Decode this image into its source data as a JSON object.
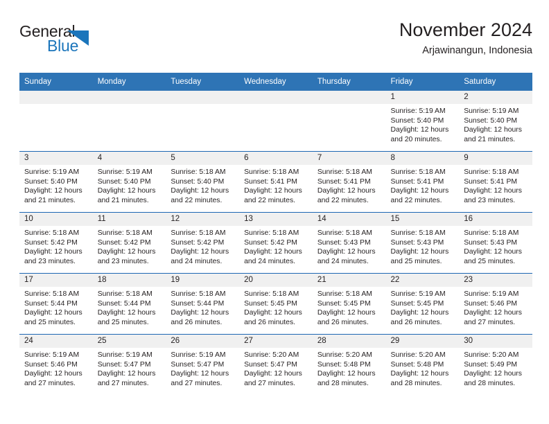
{
  "brand": {
    "line1": "General",
    "line2": "Blue",
    "triangle_color": "#1b75bb"
  },
  "header": {
    "month_title": "November 2024",
    "location": "Arjawinangun, Indonesia"
  },
  "colors": {
    "header_blue": "#2e74b5",
    "row_divider_blue": "#1b66b3",
    "daynum_band": "#f0f0f0",
    "text": "#231f20"
  },
  "weekday_headers": [
    "Sunday",
    "Monday",
    "Tuesday",
    "Wednesday",
    "Thursday",
    "Friday",
    "Saturday"
  ],
  "weeks": [
    [
      {
        "day": "",
        "sunrise": "",
        "sunset": "",
        "daylight1": "",
        "daylight2": ""
      },
      {
        "day": "",
        "sunrise": "",
        "sunset": "",
        "daylight1": "",
        "daylight2": ""
      },
      {
        "day": "",
        "sunrise": "",
        "sunset": "",
        "daylight1": "",
        "daylight2": ""
      },
      {
        "day": "",
        "sunrise": "",
        "sunset": "",
        "daylight1": "",
        "daylight2": ""
      },
      {
        "day": "",
        "sunrise": "",
        "sunset": "",
        "daylight1": "",
        "daylight2": ""
      },
      {
        "day": "1",
        "sunrise": "Sunrise: 5:19 AM",
        "sunset": "Sunset: 5:40 PM",
        "daylight1": "Daylight: 12 hours",
        "daylight2": "and 20 minutes."
      },
      {
        "day": "2",
        "sunrise": "Sunrise: 5:19 AM",
        "sunset": "Sunset: 5:40 PM",
        "daylight1": "Daylight: 12 hours",
        "daylight2": "and 21 minutes."
      }
    ],
    [
      {
        "day": "3",
        "sunrise": "Sunrise: 5:19 AM",
        "sunset": "Sunset: 5:40 PM",
        "daylight1": "Daylight: 12 hours",
        "daylight2": "and 21 minutes."
      },
      {
        "day": "4",
        "sunrise": "Sunrise: 5:19 AM",
        "sunset": "Sunset: 5:40 PM",
        "daylight1": "Daylight: 12 hours",
        "daylight2": "and 21 minutes."
      },
      {
        "day": "5",
        "sunrise": "Sunrise: 5:18 AM",
        "sunset": "Sunset: 5:40 PM",
        "daylight1": "Daylight: 12 hours",
        "daylight2": "and 22 minutes."
      },
      {
        "day": "6",
        "sunrise": "Sunrise: 5:18 AM",
        "sunset": "Sunset: 5:41 PM",
        "daylight1": "Daylight: 12 hours",
        "daylight2": "and 22 minutes."
      },
      {
        "day": "7",
        "sunrise": "Sunrise: 5:18 AM",
        "sunset": "Sunset: 5:41 PM",
        "daylight1": "Daylight: 12 hours",
        "daylight2": "and 22 minutes."
      },
      {
        "day": "8",
        "sunrise": "Sunrise: 5:18 AM",
        "sunset": "Sunset: 5:41 PM",
        "daylight1": "Daylight: 12 hours",
        "daylight2": "and 22 minutes."
      },
      {
        "day": "9",
        "sunrise": "Sunrise: 5:18 AM",
        "sunset": "Sunset: 5:41 PM",
        "daylight1": "Daylight: 12 hours",
        "daylight2": "and 23 minutes."
      }
    ],
    [
      {
        "day": "10",
        "sunrise": "Sunrise: 5:18 AM",
        "sunset": "Sunset: 5:42 PM",
        "daylight1": "Daylight: 12 hours",
        "daylight2": "and 23 minutes."
      },
      {
        "day": "11",
        "sunrise": "Sunrise: 5:18 AM",
        "sunset": "Sunset: 5:42 PM",
        "daylight1": "Daylight: 12 hours",
        "daylight2": "and 23 minutes."
      },
      {
        "day": "12",
        "sunrise": "Sunrise: 5:18 AM",
        "sunset": "Sunset: 5:42 PM",
        "daylight1": "Daylight: 12 hours",
        "daylight2": "and 24 minutes."
      },
      {
        "day": "13",
        "sunrise": "Sunrise: 5:18 AM",
        "sunset": "Sunset: 5:42 PM",
        "daylight1": "Daylight: 12 hours",
        "daylight2": "and 24 minutes."
      },
      {
        "day": "14",
        "sunrise": "Sunrise: 5:18 AM",
        "sunset": "Sunset: 5:43 PM",
        "daylight1": "Daylight: 12 hours",
        "daylight2": "and 24 minutes."
      },
      {
        "day": "15",
        "sunrise": "Sunrise: 5:18 AM",
        "sunset": "Sunset: 5:43 PM",
        "daylight1": "Daylight: 12 hours",
        "daylight2": "and 25 minutes."
      },
      {
        "day": "16",
        "sunrise": "Sunrise: 5:18 AM",
        "sunset": "Sunset: 5:43 PM",
        "daylight1": "Daylight: 12 hours",
        "daylight2": "and 25 minutes."
      }
    ],
    [
      {
        "day": "17",
        "sunrise": "Sunrise: 5:18 AM",
        "sunset": "Sunset: 5:44 PM",
        "daylight1": "Daylight: 12 hours",
        "daylight2": "and 25 minutes."
      },
      {
        "day": "18",
        "sunrise": "Sunrise: 5:18 AM",
        "sunset": "Sunset: 5:44 PM",
        "daylight1": "Daylight: 12 hours",
        "daylight2": "and 25 minutes."
      },
      {
        "day": "19",
        "sunrise": "Sunrise: 5:18 AM",
        "sunset": "Sunset: 5:44 PM",
        "daylight1": "Daylight: 12 hours",
        "daylight2": "and 26 minutes."
      },
      {
        "day": "20",
        "sunrise": "Sunrise: 5:18 AM",
        "sunset": "Sunset: 5:45 PM",
        "daylight1": "Daylight: 12 hours",
        "daylight2": "and 26 minutes."
      },
      {
        "day": "21",
        "sunrise": "Sunrise: 5:18 AM",
        "sunset": "Sunset: 5:45 PM",
        "daylight1": "Daylight: 12 hours",
        "daylight2": "and 26 minutes."
      },
      {
        "day": "22",
        "sunrise": "Sunrise: 5:19 AM",
        "sunset": "Sunset: 5:45 PM",
        "daylight1": "Daylight: 12 hours",
        "daylight2": "and 26 minutes."
      },
      {
        "day": "23",
        "sunrise": "Sunrise: 5:19 AM",
        "sunset": "Sunset: 5:46 PM",
        "daylight1": "Daylight: 12 hours",
        "daylight2": "and 27 minutes."
      }
    ],
    [
      {
        "day": "24",
        "sunrise": "Sunrise: 5:19 AM",
        "sunset": "Sunset: 5:46 PM",
        "daylight1": "Daylight: 12 hours",
        "daylight2": "and 27 minutes."
      },
      {
        "day": "25",
        "sunrise": "Sunrise: 5:19 AM",
        "sunset": "Sunset: 5:47 PM",
        "daylight1": "Daylight: 12 hours",
        "daylight2": "and 27 minutes."
      },
      {
        "day": "26",
        "sunrise": "Sunrise: 5:19 AM",
        "sunset": "Sunset: 5:47 PM",
        "daylight1": "Daylight: 12 hours",
        "daylight2": "and 27 minutes."
      },
      {
        "day": "27",
        "sunrise": "Sunrise: 5:20 AM",
        "sunset": "Sunset: 5:47 PM",
        "daylight1": "Daylight: 12 hours",
        "daylight2": "and 27 minutes."
      },
      {
        "day": "28",
        "sunrise": "Sunrise: 5:20 AM",
        "sunset": "Sunset: 5:48 PM",
        "daylight1": "Daylight: 12 hours",
        "daylight2": "and 28 minutes."
      },
      {
        "day": "29",
        "sunrise": "Sunrise: 5:20 AM",
        "sunset": "Sunset: 5:48 PM",
        "daylight1": "Daylight: 12 hours",
        "daylight2": "and 28 minutes."
      },
      {
        "day": "30",
        "sunrise": "Sunrise: 5:20 AM",
        "sunset": "Sunset: 5:49 PM",
        "daylight1": "Daylight: 12 hours",
        "daylight2": "and 28 minutes."
      }
    ]
  ]
}
